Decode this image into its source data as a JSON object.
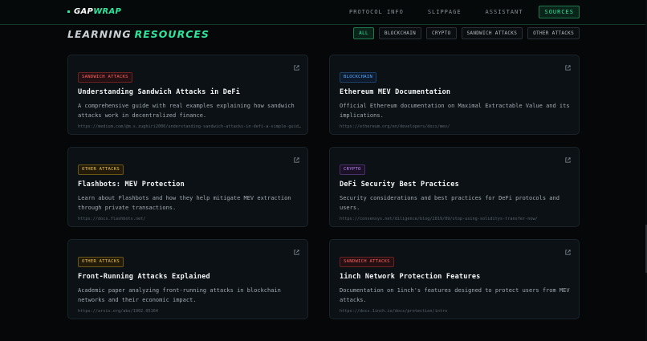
{
  "brand": {
    "prefix": "GAP",
    "suffix": "WRAP"
  },
  "nav": {
    "items": [
      "PROTOCOL INFO",
      "SLIPPAGE",
      "ASSISTANT",
      "SOURCES"
    ],
    "active": "SOURCES"
  },
  "heading": {
    "part1": "LEARNING",
    "part2": "RESOURCES"
  },
  "filters": [
    "ALL",
    "BLOCKCHAIN",
    "CRYPTO",
    "SANDWICH ATTACKS",
    "OTHER ATTACKS"
  ],
  "active_filter": "ALL",
  "resources": [
    {
      "tag": "SANDWICH ATTACKS",
      "tag_kind": "sandwich",
      "title": "Understanding Sandwich Attacks in DeFi",
      "description": "A comprehensive guide with real examples explaining how sandwich attacks work in decentralized finance.",
      "url": "https://medium.com/@m.s.zughiri2000/understanding-sandwich-attacks-in-defi-a-simple-guid…"
    },
    {
      "tag": "BLOCKCHAIN",
      "tag_kind": "blockchain",
      "title": "Ethereum MEV Documentation",
      "description": "Official Ethereum documentation on Maximal Extractable Value and its implications.",
      "url": "https://ethereum.org/en/developers/docs/mev/"
    },
    {
      "tag": "OTHER ATTACKS",
      "tag_kind": "other",
      "title": "Flashbots: MEV Protection",
      "description": "Learn about Flashbots and how they help mitigate MEV extraction through private transactions.",
      "url": "https://docs.flashbots.net/"
    },
    {
      "tag": "CRYPTO",
      "tag_kind": "crypto",
      "title": "DeFi Security Best Practices",
      "description": "Security considerations and best practices for DeFi protocols and users.",
      "url": "https://consensys.net/diligence/blog/2019/09/stop-using-soliditys-transfer-now/"
    },
    {
      "tag": "OTHER ATTACKS",
      "tag_kind": "other",
      "title": "Front-Running Attacks Explained",
      "description": "Academic paper analyzing front-running attacks in blockchain networks and their economic impact.",
      "url": "https://arxiv.org/abs/1902.05164"
    },
    {
      "tag": "SANDWICH ATTACKS",
      "tag_kind": "sandwich",
      "title": "1inch Network Protection Features",
      "description": "Documentation on 1inch's features designed to protect users from MEV attacks.",
      "url": "https://docs.1inch.io/docs/protection/intro"
    }
  ],
  "icons": {
    "external": "external-link-icon"
  },
  "colors": {
    "accent": "#2ee59d",
    "background": "#050708"
  }
}
